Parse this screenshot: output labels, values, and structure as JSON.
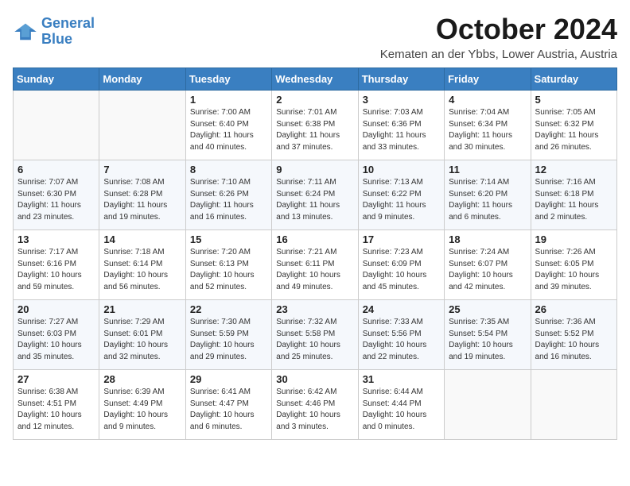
{
  "header": {
    "logo_line1": "General",
    "logo_line2": "Blue",
    "month": "October 2024",
    "location": "Kematen an der Ybbs, Lower Austria, Austria"
  },
  "days_of_week": [
    "Sunday",
    "Monday",
    "Tuesday",
    "Wednesday",
    "Thursday",
    "Friday",
    "Saturday"
  ],
  "weeks": [
    [
      {
        "num": "",
        "detail": ""
      },
      {
        "num": "",
        "detail": ""
      },
      {
        "num": "1",
        "detail": "Sunrise: 7:00 AM\nSunset: 6:40 PM\nDaylight: 11 hours and 40 minutes."
      },
      {
        "num": "2",
        "detail": "Sunrise: 7:01 AM\nSunset: 6:38 PM\nDaylight: 11 hours and 37 minutes."
      },
      {
        "num": "3",
        "detail": "Sunrise: 7:03 AM\nSunset: 6:36 PM\nDaylight: 11 hours and 33 minutes."
      },
      {
        "num": "4",
        "detail": "Sunrise: 7:04 AM\nSunset: 6:34 PM\nDaylight: 11 hours and 30 minutes."
      },
      {
        "num": "5",
        "detail": "Sunrise: 7:05 AM\nSunset: 6:32 PM\nDaylight: 11 hours and 26 minutes."
      }
    ],
    [
      {
        "num": "6",
        "detail": "Sunrise: 7:07 AM\nSunset: 6:30 PM\nDaylight: 11 hours and 23 minutes."
      },
      {
        "num": "7",
        "detail": "Sunrise: 7:08 AM\nSunset: 6:28 PM\nDaylight: 11 hours and 19 minutes."
      },
      {
        "num": "8",
        "detail": "Sunrise: 7:10 AM\nSunset: 6:26 PM\nDaylight: 11 hours and 16 minutes."
      },
      {
        "num": "9",
        "detail": "Sunrise: 7:11 AM\nSunset: 6:24 PM\nDaylight: 11 hours and 13 minutes."
      },
      {
        "num": "10",
        "detail": "Sunrise: 7:13 AM\nSunset: 6:22 PM\nDaylight: 11 hours and 9 minutes."
      },
      {
        "num": "11",
        "detail": "Sunrise: 7:14 AM\nSunset: 6:20 PM\nDaylight: 11 hours and 6 minutes."
      },
      {
        "num": "12",
        "detail": "Sunrise: 7:16 AM\nSunset: 6:18 PM\nDaylight: 11 hours and 2 minutes."
      }
    ],
    [
      {
        "num": "13",
        "detail": "Sunrise: 7:17 AM\nSunset: 6:16 PM\nDaylight: 10 hours and 59 minutes."
      },
      {
        "num": "14",
        "detail": "Sunrise: 7:18 AM\nSunset: 6:14 PM\nDaylight: 10 hours and 56 minutes."
      },
      {
        "num": "15",
        "detail": "Sunrise: 7:20 AM\nSunset: 6:13 PM\nDaylight: 10 hours and 52 minutes."
      },
      {
        "num": "16",
        "detail": "Sunrise: 7:21 AM\nSunset: 6:11 PM\nDaylight: 10 hours and 49 minutes."
      },
      {
        "num": "17",
        "detail": "Sunrise: 7:23 AM\nSunset: 6:09 PM\nDaylight: 10 hours and 45 minutes."
      },
      {
        "num": "18",
        "detail": "Sunrise: 7:24 AM\nSunset: 6:07 PM\nDaylight: 10 hours and 42 minutes."
      },
      {
        "num": "19",
        "detail": "Sunrise: 7:26 AM\nSunset: 6:05 PM\nDaylight: 10 hours and 39 minutes."
      }
    ],
    [
      {
        "num": "20",
        "detail": "Sunrise: 7:27 AM\nSunset: 6:03 PM\nDaylight: 10 hours and 35 minutes."
      },
      {
        "num": "21",
        "detail": "Sunrise: 7:29 AM\nSunset: 6:01 PM\nDaylight: 10 hours and 32 minutes."
      },
      {
        "num": "22",
        "detail": "Sunrise: 7:30 AM\nSunset: 5:59 PM\nDaylight: 10 hours and 29 minutes."
      },
      {
        "num": "23",
        "detail": "Sunrise: 7:32 AM\nSunset: 5:58 PM\nDaylight: 10 hours and 25 minutes."
      },
      {
        "num": "24",
        "detail": "Sunrise: 7:33 AM\nSunset: 5:56 PM\nDaylight: 10 hours and 22 minutes."
      },
      {
        "num": "25",
        "detail": "Sunrise: 7:35 AM\nSunset: 5:54 PM\nDaylight: 10 hours and 19 minutes."
      },
      {
        "num": "26",
        "detail": "Sunrise: 7:36 AM\nSunset: 5:52 PM\nDaylight: 10 hours and 16 minutes."
      }
    ],
    [
      {
        "num": "27",
        "detail": "Sunrise: 6:38 AM\nSunset: 4:51 PM\nDaylight: 10 hours and 12 minutes."
      },
      {
        "num": "28",
        "detail": "Sunrise: 6:39 AM\nSunset: 4:49 PM\nDaylight: 10 hours and 9 minutes."
      },
      {
        "num": "29",
        "detail": "Sunrise: 6:41 AM\nSunset: 4:47 PM\nDaylight: 10 hours and 6 minutes."
      },
      {
        "num": "30",
        "detail": "Sunrise: 6:42 AM\nSunset: 4:46 PM\nDaylight: 10 hours and 3 minutes."
      },
      {
        "num": "31",
        "detail": "Sunrise: 6:44 AM\nSunset: 4:44 PM\nDaylight: 10 hours and 0 minutes."
      },
      {
        "num": "",
        "detail": ""
      },
      {
        "num": "",
        "detail": ""
      }
    ]
  ]
}
